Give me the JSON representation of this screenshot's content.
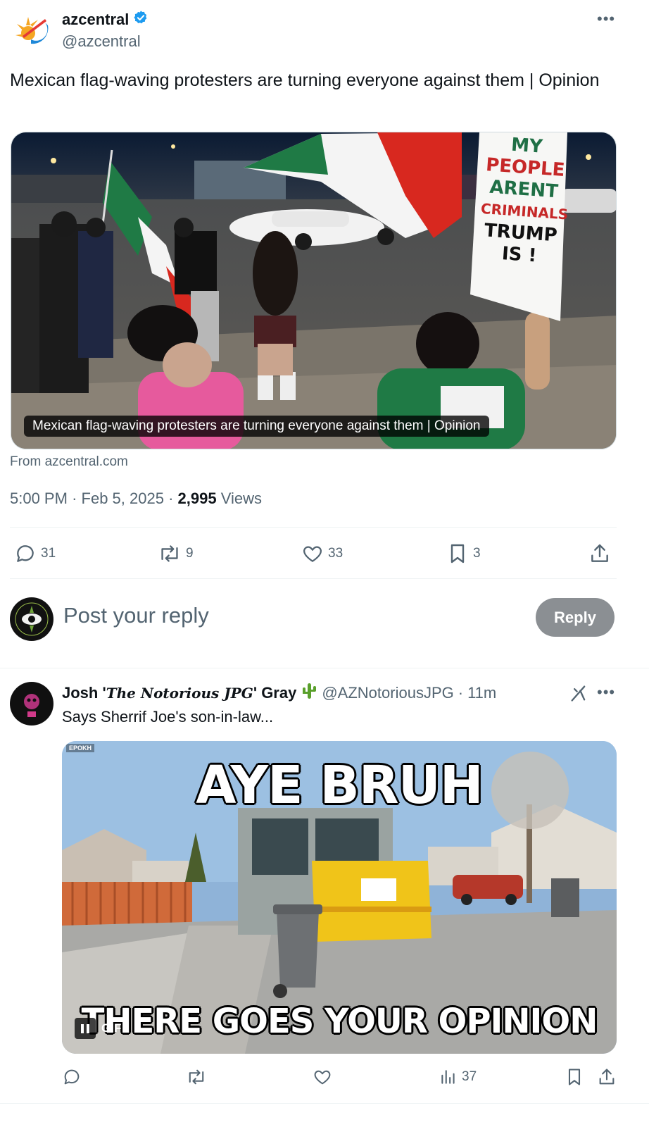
{
  "post": {
    "author_name": "azcentral",
    "author_handle": "@azcentral",
    "text": "Mexican flag-waving protesters are turning everyone against them | Opinion",
    "card": {
      "caption": "Mexican flag-waving protesters are turning everyone against them | Opinion",
      "sign_text": [
        "MY",
        "PEOPLE",
        "ARENT",
        "CRIMINALS",
        "TRUMP",
        "IS !"
      ],
      "source": "From azcentral.com"
    },
    "time": "5:00 PM",
    "date": "Feb 5, 2025",
    "views_count": "2,995",
    "views_label": "Views",
    "sep": "·",
    "actions": {
      "replies": "31",
      "reposts": "9",
      "likes": "33",
      "bookmarks": "3"
    }
  },
  "composer": {
    "placeholder": "Post your reply",
    "button": "Reply"
  },
  "reply": {
    "name_prefix": "Josh '",
    "name_fancy": "The Notorious JPG",
    "name_suffix": "' Gray",
    "handle": "@AZNotoriousJPG",
    "time": "11m",
    "text": "Says Sherrif Joe's son-in-law...",
    "gif": {
      "top_text": "AYE BRUH",
      "bottom_text": "THERE GOES YOUR OPINION",
      "badge": "GIF",
      "watermark": "EPOKH"
    },
    "actions": {
      "views": "37"
    }
  },
  "colors": {
    "text_primary": "#0f1419",
    "text_secondary": "#536471",
    "verified": "#1d9bf0",
    "reply_button": "#8b8f93",
    "divider": "#eff3f4"
  }
}
